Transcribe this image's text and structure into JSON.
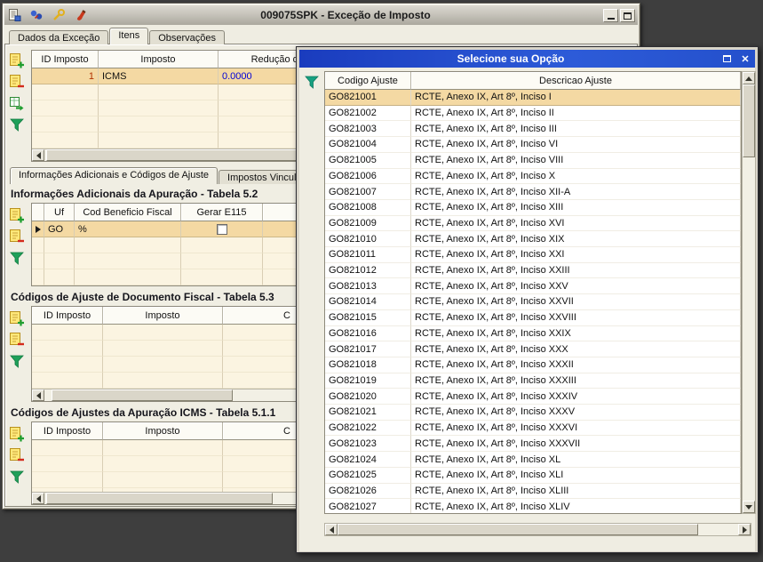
{
  "main_window": {
    "title": "009075SPK - Exceção de Imposto",
    "tabs": [
      {
        "label": "Dados da Exceção"
      },
      {
        "label": "Itens"
      },
      {
        "label": "Observações"
      }
    ],
    "items_grid": {
      "columns": [
        "ID Imposto",
        "Imposto",
        "Redução de Ba"
      ],
      "rows": [
        {
          "id": "1",
          "imposto": "ICMS",
          "reducao": "0.0000"
        }
      ]
    },
    "inner_tabs": [
      {
        "label": "Informações Adicionais e Códigos de Ajuste"
      },
      {
        "label": "Impostos Vinculad"
      }
    ],
    "section_52": {
      "title": "Informações Adicionais da Apuração - Tabela 5.2",
      "columns": [
        "Uf",
        "Cod Beneficio Fiscal",
        "Gerar E115"
      ],
      "rows": [
        {
          "uf": "GO",
          "cod_beneficio_fiscal": "%",
          "gerar_e115": false
        }
      ]
    },
    "section_53": {
      "title": "Códigos de Ajuste de Documento Fiscal - Tabela 5.3",
      "columns": [
        "ID Imposto",
        "Imposto",
        "C"
      ]
    },
    "section_511": {
      "title": "Códigos de Ajustes da Apuração ICMS - Tabela 5.1.1",
      "columns": [
        "ID Imposto",
        "Imposto",
        "C"
      ]
    }
  },
  "popup": {
    "title": "Selecione sua Opção",
    "close_glyph": "✕",
    "columns": [
      "Codigo Ajuste",
      "Descricao Ajuste"
    ],
    "rows": [
      {
        "code": "GO821001",
        "desc": "RCTE, Anexo IX, Art 8º, Inciso I"
      },
      {
        "code": "GO821002",
        "desc": "RCTE, Anexo IX, Art 8º, Inciso II"
      },
      {
        "code": "GO821003",
        "desc": "RCTE, Anexo IX, Art 8º, Inciso III"
      },
      {
        "code": "GO821004",
        "desc": "RCTE, Anexo IX, Art 8º, Inciso VI"
      },
      {
        "code": "GO821005",
        "desc": "RCTE, Anexo IX, Art 8º, Inciso VIII"
      },
      {
        "code": "GO821006",
        "desc": "RCTE, Anexo IX, Art 8º, Inciso X"
      },
      {
        "code": "GO821007",
        "desc": "RCTE, Anexo IX, Art 8º, Inciso XII-A"
      },
      {
        "code": "GO821008",
        "desc": "RCTE, Anexo IX, Art 8º, Inciso XIII"
      },
      {
        "code": "GO821009",
        "desc": "RCTE, Anexo IX, Art 8º, Inciso XVI"
      },
      {
        "code": "GO821010",
        "desc": "RCTE, Anexo IX, Art 8º, Inciso XIX"
      },
      {
        "code": "GO821011",
        "desc": "RCTE, Anexo IX, Art 8º, Inciso XXI"
      },
      {
        "code": "GO821012",
        "desc": "RCTE, Anexo IX, Art 8º, Inciso XXIII"
      },
      {
        "code": "GO821013",
        "desc": "RCTE, Anexo IX, Art 8º, Inciso XXV"
      },
      {
        "code": "GO821014",
        "desc": "RCTE, Anexo IX, Art 8º, Inciso XXVII"
      },
      {
        "code": "GO821015",
        "desc": "RCTE, Anexo IX, Art 8º, Inciso XXVIII"
      },
      {
        "code": "GO821016",
        "desc": "RCTE, Anexo IX, Art 8º, Inciso XXIX"
      },
      {
        "code": "GO821017",
        "desc": "RCTE, Anexo IX, Art 8º, Inciso XXX"
      },
      {
        "code": "GO821018",
        "desc": "RCTE, Anexo IX, Art 8º, Inciso XXXII"
      },
      {
        "code": "GO821019",
        "desc": "RCTE, Anexo IX, Art 8º, Inciso XXXIII"
      },
      {
        "code": "GO821020",
        "desc": "RCTE, Anexo IX, Art 8º, Inciso XXXIV"
      },
      {
        "code": "GO821021",
        "desc": "RCTE, Anexo IX, Art 8º, Inciso XXXV"
      },
      {
        "code": "GO821022",
        "desc": "RCTE, Anexo IX, Art 8º, Inciso XXXVI"
      },
      {
        "code": "GO821023",
        "desc": "RCTE, Anexo IX, Art 8º, Inciso XXXVII"
      },
      {
        "code": "GO821024",
        "desc": "RCTE, Anexo IX, Art 8º, Inciso XL"
      },
      {
        "code": "GO821025",
        "desc": "RCTE, Anexo IX, Art 8º, Inciso XLI"
      },
      {
        "code": "GO821026",
        "desc": "RCTE, Anexo IX, Art 8º, Inciso XLIII"
      },
      {
        "code": "GO821027",
        "desc": "RCTE, Anexo IX, Art 8º, Inciso XLIV"
      }
    ]
  },
  "colors": {
    "popup_titlebar_blue": "#1A3CBE",
    "selection_peach": "#F4D9A3",
    "grid_cream": "#FBF4E1",
    "value_blue": "#0000D8",
    "value_red": "#B03000"
  }
}
